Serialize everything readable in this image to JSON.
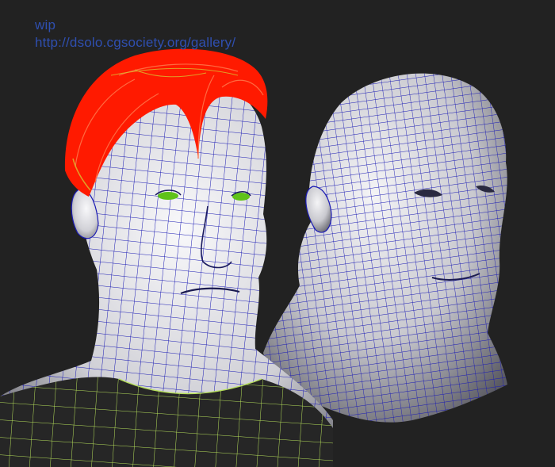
{
  "caption": {
    "line1": "wip",
    "line2": "http://dsolo.cgsociety.org/gallery/"
  },
  "colors": {
    "background": "#222222",
    "caption_text": "#2f4fb0",
    "wireframe": "#1a1ab4",
    "skin": "#dcdce0",
    "hair": "#ff1a00",
    "eyes": "#5fc21a",
    "shirt_wire": "#b6e05a"
  }
}
